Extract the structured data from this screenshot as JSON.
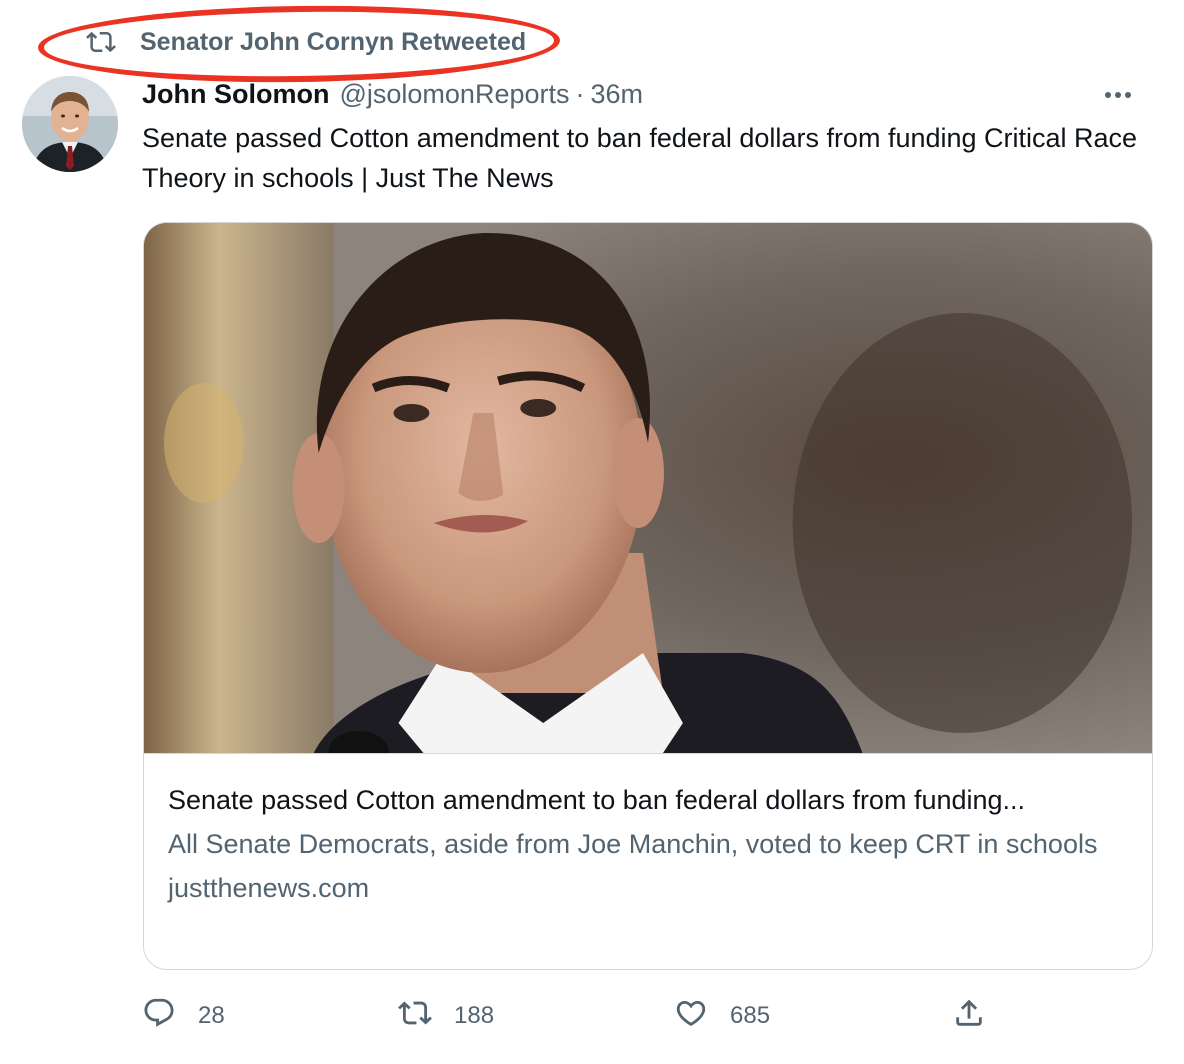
{
  "retweet_context": {
    "text": "Senator John Cornyn Retweeted",
    "icon": "retweet-icon"
  },
  "tweet": {
    "author_name": "John Solomon",
    "author_handle": "@jsolomonReports",
    "separator": "·",
    "timestamp": "36m",
    "text": "Senate passed Cotton amendment to ban federal dollars from funding Critical Race Theory in schools | Just The News"
  },
  "card": {
    "title": "Senate passed Cotton amendment to ban federal dollars from funding...",
    "description": "All Senate Democrats, aside from Joe Manchin, voted to keep CRT in schools",
    "domain": "justthenews.com"
  },
  "actions": {
    "reply_count": "28",
    "retweet_count": "188",
    "like_count": "685"
  },
  "colors": {
    "annotation": "#ea3323",
    "secondary_text": "#536471",
    "primary_text": "#0f1419",
    "border": "#cfd9de"
  }
}
